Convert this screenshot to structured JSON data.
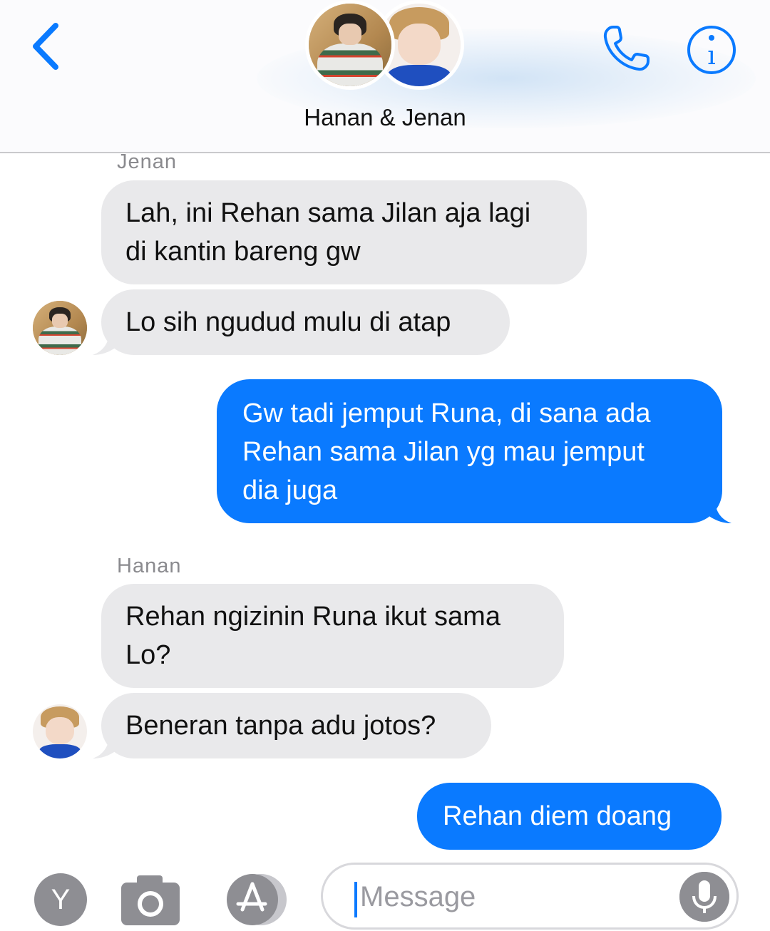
{
  "header": {
    "title": "Hanan & Jenan",
    "back_icon": "chevron-left-icon",
    "call_icon": "phone-icon",
    "info_icon": "info-icon",
    "accent": "#0a7aff"
  },
  "messages": [
    {
      "sender": "Jenan",
      "direction": "incoming",
      "text": "Lah, ini Rehan sama Jilan aja lagi\ndi kantin bareng gw"
    },
    {
      "sender": "Jenan",
      "direction": "incoming",
      "text": "Lo sih ngudud mulu di atap"
    },
    {
      "sender": "me",
      "direction": "outgoing",
      "text": "Gw tadi jemput Runa, di sana ada\nRehan sama Jilan yg mau jemput\ndia juga"
    },
    {
      "sender": "Hanan",
      "direction": "incoming",
      "text": "Rehan ngizinin Runa ikut sama\nLo?"
    },
    {
      "sender": "Hanan",
      "direction": "incoming",
      "text": "Beneran tanpa adu jotos?"
    },
    {
      "sender": "me",
      "direction": "outgoing",
      "text": "Rehan diem doang"
    }
  ],
  "labels": {
    "jenan": "Jenan",
    "hanan": "Hanan"
  },
  "input_bar": {
    "apps_label": "Y",
    "placeholder": "Message",
    "camera_icon": "camera-icon",
    "appstore_icon": "app-store-icon",
    "mic_icon": "microphone-icon"
  },
  "colors": {
    "incoming_bubble": "#e9e9eb",
    "outgoing_bubble": "#0a7aff"
  }
}
